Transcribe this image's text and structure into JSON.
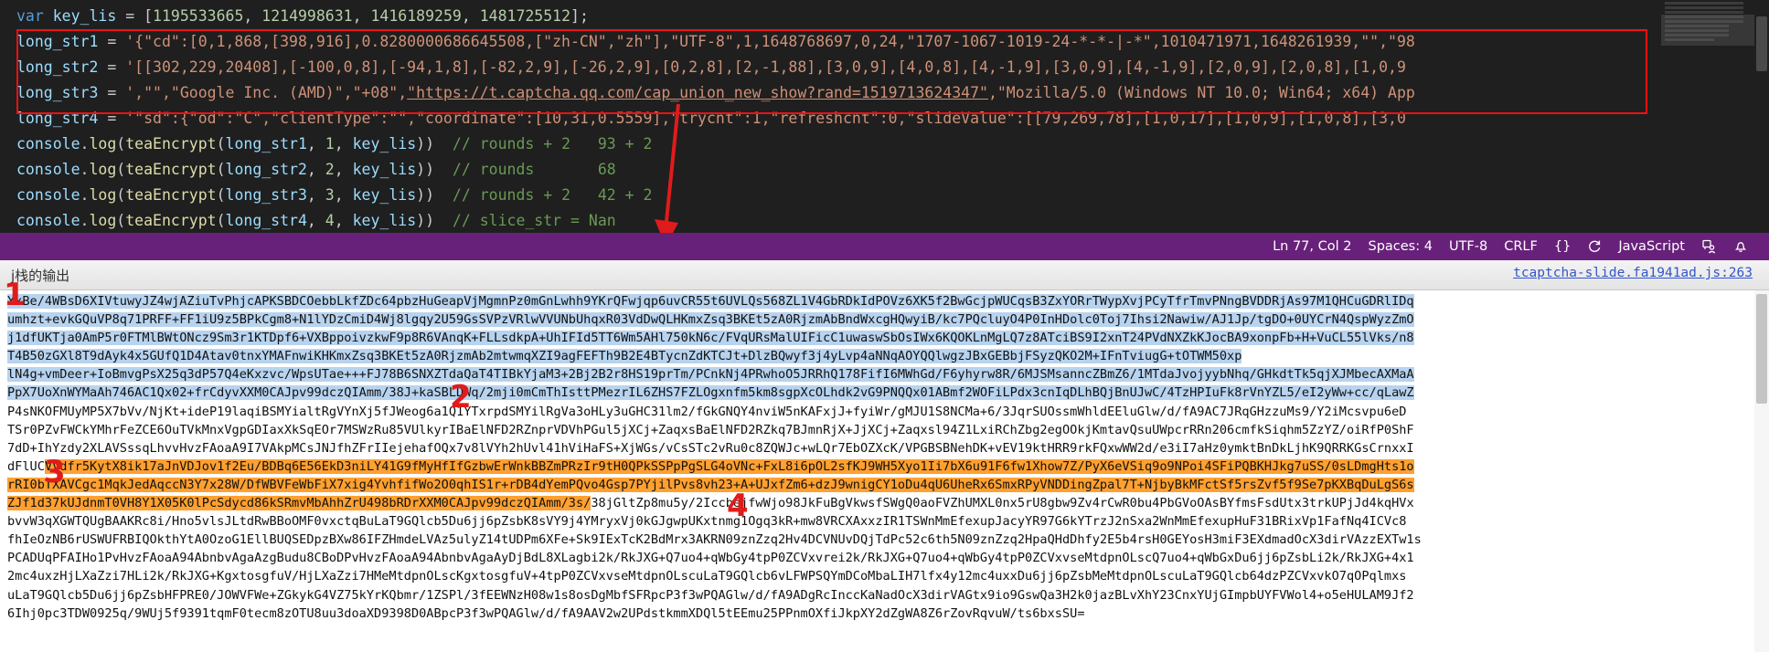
{
  "editor": {
    "lines": [
      {
        "id": "key_lis",
        "segments": [
          {
            "t": "var ",
            "c": "kw"
          },
          {
            "t": "key_lis",
            "c": "vname"
          },
          {
            "t": " = [",
            "c": "punct"
          },
          {
            "t": "1195533665",
            "c": "num"
          },
          {
            "t": ", ",
            "c": "punct"
          },
          {
            "t": "1214998631",
            "c": "num"
          },
          {
            "t": ", ",
            "c": "punct"
          },
          {
            "t": "1416189259",
            "c": "num"
          },
          {
            "t": ", ",
            "c": "punct"
          },
          {
            "t": "1481725512",
            "c": "num"
          },
          {
            "t": "];",
            "c": "punct"
          }
        ]
      },
      {
        "id": "long_str1",
        "segments": [
          {
            "t": "long_str1",
            "c": "vname"
          },
          {
            "t": " = ",
            "c": "punct"
          },
          {
            "t": "'{\"cd\":[0,1,868,[398,916],0.8280000686645508,[\"zh-CN\",\"zh\"],\"UTF-8\",1,1648768697,0,24,\"1707-1067-1019-24-*-*-|-*\",1010471971,1648261939,\"\",\"98",
            "c": "str"
          }
        ]
      },
      {
        "id": "long_str2",
        "segments": [
          {
            "t": "long_str2",
            "c": "vname"
          },
          {
            "t": " = ",
            "c": "punct"
          },
          {
            "t": "'[[302,229,20408],[-100,0,8],[-94,1,8],[-82,2,9],[-26,2,9],[0,2,8],[2,-1,88],[3,0,9],[4,0,8],[4,-1,9],[3,0,9],[4,-1,9],[2,0,9],[2,0,8],[1,0,9",
            "c": "str"
          }
        ]
      },
      {
        "id": "long_str3",
        "segments": [
          {
            "t": "long_str3",
            "c": "vname"
          },
          {
            "t": " = ",
            "c": "punct"
          },
          {
            "t": "',\"\",\"Google Inc. (AMD)\",\"+08\",",
            "c": "str"
          },
          {
            "t": "\"https://t.captcha.qq.com/cap_union_new_show?rand=1519713624347\"",
            "c": "str u"
          },
          {
            "t": ",\"Mozilla/5.0 (Windows NT 10.0; Win64; x64) App",
            "c": "str"
          }
        ]
      },
      {
        "id": "long_str4",
        "segments": [
          {
            "t": "long_str4",
            "c": "vname"
          },
          {
            "t": " = ",
            "c": "punct"
          },
          {
            "t": "'\"sd\":{\"od\":\"C\",\"clientType\":\"\",\"coordinate\":[10,31,0.5559],\"trycnt\":1,\"refreshcnt\":0,\"slideValue\":[[79,269,78],[1,0,17],[1,0,9],[1,0,8],[3,0",
            "c": "str"
          }
        ]
      },
      {
        "id": "log1",
        "segments": [
          {
            "t": "console",
            "c": "vname"
          },
          {
            "t": ".",
            "c": "punct"
          },
          {
            "t": "log",
            "c": "fn"
          },
          {
            "t": "(",
            "c": "punct"
          },
          {
            "t": "teaEncrypt",
            "c": "fn"
          },
          {
            "t": "(",
            "c": "punct"
          },
          {
            "t": "long_str1",
            "c": "vname"
          },
          {
            "t": ", ",
            "c": "punct"
          },
          {
            "t": "1",
            "c": "num"
          },
          {
            "t": ", ",
            "c": "punct"
          },
          {
            "t": "key_lis",
            "c": "vname"
          },
          {
            "t": "))  ",
            "c": "punct"
          },
          {
            "t": "// rounds + 2   93 + 2",
            "c": "com"
          }
        ]
      },
      {
        "id": "log2",
        "segments": [
          {
            "t": "console",
            "c": "vname"
          },
          {
            "t": ".",
            "c": "punct"
          },
          {
            "t": "log",
            "c": "fn"
          },
          {
            "t": "(",
            "c": "punct"
          },
          {
            "t": "teaEncrypt",
            "c": "fn"
          },
          {
            "t": "(",
            "c": "punct"
          },
          {
            "t": "long_str2",
            "c": "vname"
          },
          {
            "t": ", ",
            "c": "punct"
          },
          {
            "t": "2",
            "c": "num"
          },
          {
            "t": ", ",
            "c": "punct"
          },
          {
            "t": "key_lis",
            "c": "vname"
          },
          {
            "t": "))  ",
            "c": "punct"
          },
          {
            "t": "// rounds       68",
            "c": "com"
          }
        ]
      },
      {
        "id": "log3",
        "segments": [
          {
            "t": "console",
            "c": "vname"
          },
          {
            "t": ".",
            "c": "punct"
          },
          {
            "t": "log",
            "c": "fn"
          },
          {
            "t": "(",
            "c": "punct"
          },
          {
            "t": "teaEncrypt",
            "c": "fn"
          },
          {
            "t": "(",
            "c": "punct"
          },
          {
            "t": "long_str3",
            "c": "vname"
          },
          {
            "t": ", ",
            "c": "punct"
          },
          {
            "t": "3",
            "c": "num"
          },
          {
            "t": ", ",
            "c": "punct"
          },
          {
            "t": "key_lis",
            "c": "vname"
          },
          {
            "t": "))  ",
            "c": "punct"
          },
          {
            "t": "// rounds + 2   42 + 2",
            "c": "com"
          }
        ]
      },
      {
        "id": "log4",
        "segments": [
          {
            "t": "console",
            "c": "vname"
          },
          {
            "t": ".",
            "c": "punct"
          },
          {
            "t": "log",
            "c": "fn"
          },
          {
            "t": "(",
            "c": "punct"
          },
          {
            "t": "teaEncrypt",
            "c": "fn"
          },
          {
            "t": "(",
            "c": "punct"
          },
          {
            "t": "long_str4",
            "c": "vname"
          },
          {
            "t": ", ",
            "c": "punct"
          },
          {
            "t": "4",
            "c": "num"
          },
          {
            "t": ", ",
            "c": "punct"
          },
          {
            "t": "key_lis",
            "c": "vname"
          },
          {
            "t": "))  ",
            "c": "punct"
          },
          {
            "t": "// slice_str = Nan",
            "c": "com"
          }
        ]
      }
    ]
  },
  "statusbar": {
    "cursor": "Ln 77, Col 2",
    "spaces": "Spaces: 4",
    "encoding": "UTF-8",
    "eol": "CRLF",
    "braces": "{}",
    "language": "JavaScript",
    "background": "#68217a"
  },
  "console": {
    "header_title": "j栈的输出",
    "source_link": "tcaptcha-slide.fa1941ad.js:263",
    "markers": [
      "1",
      "2",
      "3",
      "4"
    ],
    "highlight_blue": "#b7d3ef",
    "highlight_orange": "#ffa030",
    "lines": [
      {
        "hl": "blue",
        "text": "YxBe/4WBsD6XIVtuwyJZ4wjAZiuTvPhjcAPKSBDCOebbLkfZDc64pbzHuGeapVjMgmnPz0mGnLwhh9YKrQFwjqp6uvCR55t6UVLQs568ZL1V4GbRDkIdPOVz6XK5f2BwGcjpWUCqsB3ZxYORrTWypXvjPCyTfrTmvPNngBVDDRjAs97M1QHCuGDRlIDq"
      },
      {
        "hl": "blue",
        "text": "umhzt+evkGQuVP8q71PRFF+FF1iU9z5BPkCgm8+N1lYDzCmiD4Wj8lgqy2U59GsSVPzVRlwVVUNbUhqxR03VdDwQLHKmxZsq3BKEt5zA0RjzmAbBndWxcgHQwyiB/kc7PQcluyO4P0InHDolc0Toj7Ihsi2Nawiw/AJ1Jp/tgDO+0UYCrN4QspWyzZmO"
      },
      {
        "hl": "blue",
        "text": "j1dfUKTja0AmP5r0FTMlBWtONcz9Sm3r1KTDpf6+VXBppoivzkwF9p8R6VAnqK+FLLsdkpA+UhIFId5TT6Wm5AHl750kN6c/FVqURsMalUIFicC1uwaswSbOsIWx6KQOKLnMgLQ7z8ATciBS9I2xnT24PVdNXZkKJocBA9xonpFb+H+VuCL55lVks/n8"
      },
      {
        "hl": "blue",
        "text": "T4B50zGXl8T9dAyk4x5GUfQ1D4Atav0tnxYMAFnwiKHKmxZsq3BKEt5zA0RjzmAb2mtwmqXZI9agFEFTh9B2E4BTycnZdKTCJt+DlzBQwyf3j4yLvp4aNNqAOYQQlwgzJBxGEBbjFSyzQKO2M+IFnTviugG+tOTWM50xp"
      },
      {
        "hl": "blue",
        "text": "lN4g+vmDeer+IoBmvgPsX25q3dP57Q4eKxzvc/WpsUTae+++FJ78B6SNXZTdaQaT4TIBkYjaM3+2Bj2B2r8HS19prTm/PCnkNj4PRwhoO5JRRhQ178FifI6MWhGd/F6yhyrw8R/6MJSMsanncZBmZ6/1MTdaJvojyybNhq/GHkdtTk5qjXJMbecAXMaA"
      },
      {
        "hl": "blue",
        "text": "PpX7UoXnWYMaAh746AC1Qx02+frCdyvXXM0CAJpv99dczQIAmm/38J+kaSBLDWq/2mji0mCmThIsttPMezrIL6ZHS7FZLOgxnfm5km8sgpXcOLhdk2vG9PNQQx01ABmf2WOFiLPdx3cnIqDLhBQjBnUJwC/4TzHPIuFk8rVnYZL5/eI2yWw+cc/qLawZ"
      },
      {
        "hl": "none",
        "text": "P4sNKOFMUyMP5X7bVv/NjKt+ideP19laqiBSMYialtRgVYnXj5fJWeog6a1Q1YTxrpdSMYilRgVa3oHLy3uGHC31lm2/fGkGNQY4nviW5nKAFxjJ+fyiWr/gMJU1S8NCMa+6/3JqrSUOssmWhldEEluGlw/d/fA9AC7JRqGHzzuMs9/Y2iMcsvpu6eD"
      },
      {
        "hl": "none",
        "text": "TSr0PZvFWCkYMhrFeZCE6OuTVkMnxVgpGDIaxXkSqEOr7MSWzRu85VUlkyrIBaElNFD2RZnprVDVhPGul5jXCj+ZaqxsBaElNFD2RZkq7BJmnRjX+JjXCj+Zaqxsl94Z1LxiRChZbg2egOOkjKmtavQsuUWpcrRRn206cmfkSiqhm5ZzYZ/oiRfP0ShF"
      },
      {
        "hl": "none",
        "text": "7dD+IhYzdy2XLAVSssqLhvvHvzFAoaA9I7VAkpMCsJNJfhZFrIIejehafOQx7v8lVYh2hUvl41hViHaFS+XjWGs/vCsSTc2vRu0c8ZQWJc+wLQr7EbOZXcK/VPGBSBNehDK+vEV19ktHRR9rkFQxwWW2d/e3iI7aHz0ymktBnDkLjhK9QRRKGsCrnxxI"
      },
      {
        "hl": "orange_mid",
        "pre": "dFlUC",
        "text": "VVdfr5KytX8ik17aJnVDJov1f2Eu/BDBq6E56EkD3niLY41G9fMyHfIfGzbwErWnkBBZmPRzIr9tH0QPkSSPpPgSLG4oVNc+FxL8i6pOL2sfKJ9WH5Xyo1Ii7bX6u91F6fw1Xhow7Z/PyX6eVSiq9o9NPoi4SFiPQBKHJkg7uSS/0sLDmgHts1o"
      },
      {
        "hl": "orange",
        "text": "rRI0bTXAVCgc1MqkJedAqccN3Y7x28W/DfWBVFeWbFiX7xig4YvhfifWo2O0qhIS1r+rDB4dYemPQvo4Gsp7PYjilPvs8vh23+A+UJxfZm6+dzJ9wnigCY1oDu4qU6UheRx6SmxRPyVNDDingZpal7T+NjbyBkMFctSf5rsZvf5f9Se7pKXBqDuLgS6s"
      },
      {
        "hl": "orange_end",
        "text": "ZJf1d37kUJdnmT0VH8Y1X05K0lPcSdycd86kSRmvMbAhhZrU498bRDrXXM0CAJpv99dczQIAmm/3s/",
        "post": "38jGltZp8mu5y/2IccbejfwWjo98JkFuBgVkwsfSWgQ0aoFVZhUMXL0nx5rU8gbw9Zv4rCwR0bu4PbGVoOAsBYfmsFsdUtx3trkUPjJd4kqHVx"
      },
      {
        "hl": "none",
        "text": "bvvW3qXGWTQUgBAAKRc8i/Hno5vlsJLtdRwBBoOMF0vxctqBuLaT9GQlcb5Du6jj6pZsbK8sVY9j4YMryxVj0kGJgwpUKxtnmg1Ogq3kR+mw8VRCXAxxzIR1TSWnMmEfexupJacyYR97G6kYTrzJ2nSxa2WnMmEfexupHuF31BRixVp1FafNq4ICVc8"
      },
      {
        "hl": "none",
        "text": "fhIeOzNB6rUSWUFRBIQOkthYtA0OzoG1EllBUQSEDpzBXw86IFZHmdeLVAz5ulyZ14tUDPm6XFe+Sk9IExTcK2BdMrx3AKRN09znZzq2Hv4DCVNUvDQjTdPc52c6th5N09znZzq2HpaQHdDhfy2E5b4rsH0GEYosH3miF3EXdmadOcX3dirVAzzEXTw1s"
      },
      {
        "hl": "none",
        "text": "PCADUqPFAIHo1PvHvzFAoaA94AbnbvAgaAzgBudu8CBoDPvHvzFAoaA94AbnbvAgaAyDjBdL8XLagbi2k/RkJXG+Q7uo4+qWbGy4tpP0ZCVxvrei2k/RkJXG+Q7uo4+qWbGy4tpP0ZCVxvseMtdpnOLscQ7uo4+qWbGxDu6jj6pZsbLi2k/RkJXG+4x1"
      },
      {
        "hl": "none",
        "text": "2mc4uxzHjLXaZzi7HLi2k/RkJXG+KgxtosgfuV/HjLXaZzi7HMeMtdpnOLscKgxtosgfuV+4tpP0ZCVxvseMtdpnOLscuLaT9GQlcb6vLFWPSQYmDCoMbaLIH7lfx4y12mc4uxxDu6jj6pZsbMeMtdpnOLscuLaT9GQlcb64dzPZCVxvkO7qOPqlmxs"
      },
      {
        "hl": "none",
        "text": "uLaT9GQlcb5Du6jj6pZsbHFPRE0/JOWVFWe+ZGkykG4VZ75kYrKQbmr/1ZSPl/3fEEWNzH08w1s8osDgMbfSFRpcP3f3wPQAGlw/d/fA9ADgRcInccKaNadOcX3dirVAGtx9io9GswQa3H2k0jazBLvXhY23CnxYUjGImpbUYFVWol4+o5eHULAM9Jf2"
      },
      {
        "hl": "none",
        "text": "6Ihj0pc3TDW0925q/9WUj5f9391tqmF0tecm8zOTU8uu3doaXD9398D0ABpcP3f3wPQAGlw/d/fA9AAV2w2UPdstkmmXDQl5tEEmu25PPnmOXfiJkpXY2dZgWA8Z6rZovRqvuW/ts6bxsSU="
      }
    ]
  }
}
